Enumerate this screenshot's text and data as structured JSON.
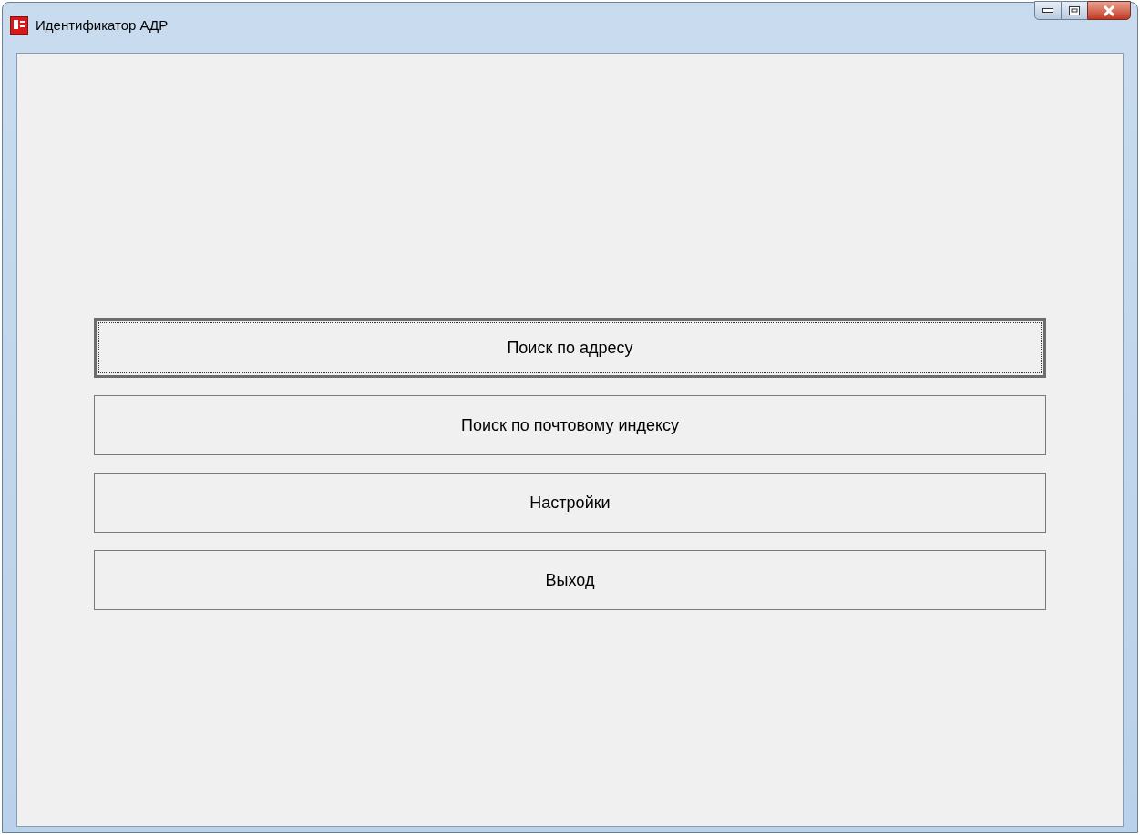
{
  "window": {
    "title": "Идентификатор АДР"
  },
  "buttons": [
    {
      "label": "Поиск по адресу",
      "focused": true
    },
    {
      "label": "Поиск по почтовому индексу",
      "focused": false
    },
    {
      "label": "Настройки",
      "focused": false
    },
    {
      "label": "Выход",
      "focused": false
    }
  ]
}
